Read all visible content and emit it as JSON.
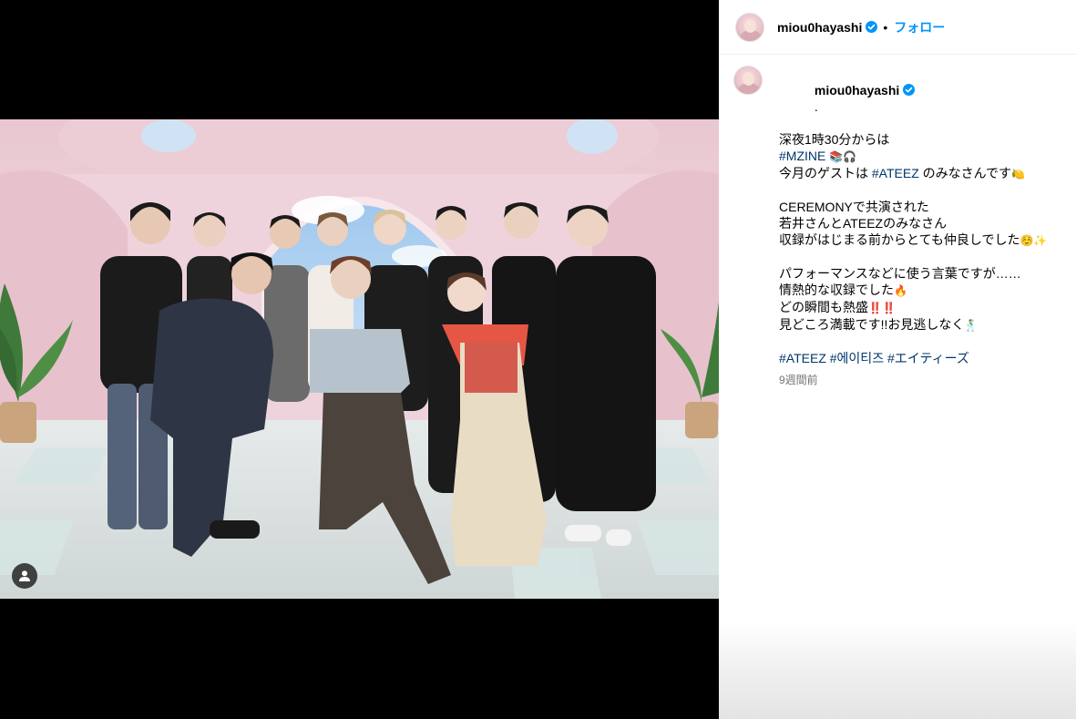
{
  "post": {
    "username": "miou0hayashi",
    "verified": true,
    "follow_label": "フォロー",
    "separator": "•"
  },
  "caption": {
    "username": "miou0hayashi",
    "after_name": ".",
    "line1": "深夜1時30分からは",
    "line2_tag": "#MZINE",
    "line2_emoji": "📚🎧",
    "line3_pre": "今月のゲストは ",
    "line3_tag": "#ATEEZ",
    "line3_post": " のみなさんです",
    "line3_emoji": "🍋",
    "line4": "CEREMONYで共演された",
    "line5": "若井さんとATEEZのみなさん",
    "line6": "収録がはじまる前からとても仲良しでした",
    "line6_emoji": "☺️✨",
    "line7": "パフォーマンスなどに使う言葉ですが……",
    "line8": "情熱的な収録でした",
    "line8_emoji": "🔥",
    "line9": "どの瞬間も熱盛",
    "line9_emoji": "‼️‼️",
    "line10": "見どころ満載です!!お見逃しなく",
    "line10_emoji": "🕺",
    "tags": [
      "#ATEEZ",
      "#에이티즈",
      "#エイティーズ"
    ],
    "time": "9週間前"
  },
  "icons": {
    "verified": "verified-badge-icon",
    "tag": "user-tag-icon"
  },
  "colors": {
    "link": "#00376b",
    "follow": "#0095f6",
    "verified": "#0095f6",
    "muted": "#737373"
  }
}
